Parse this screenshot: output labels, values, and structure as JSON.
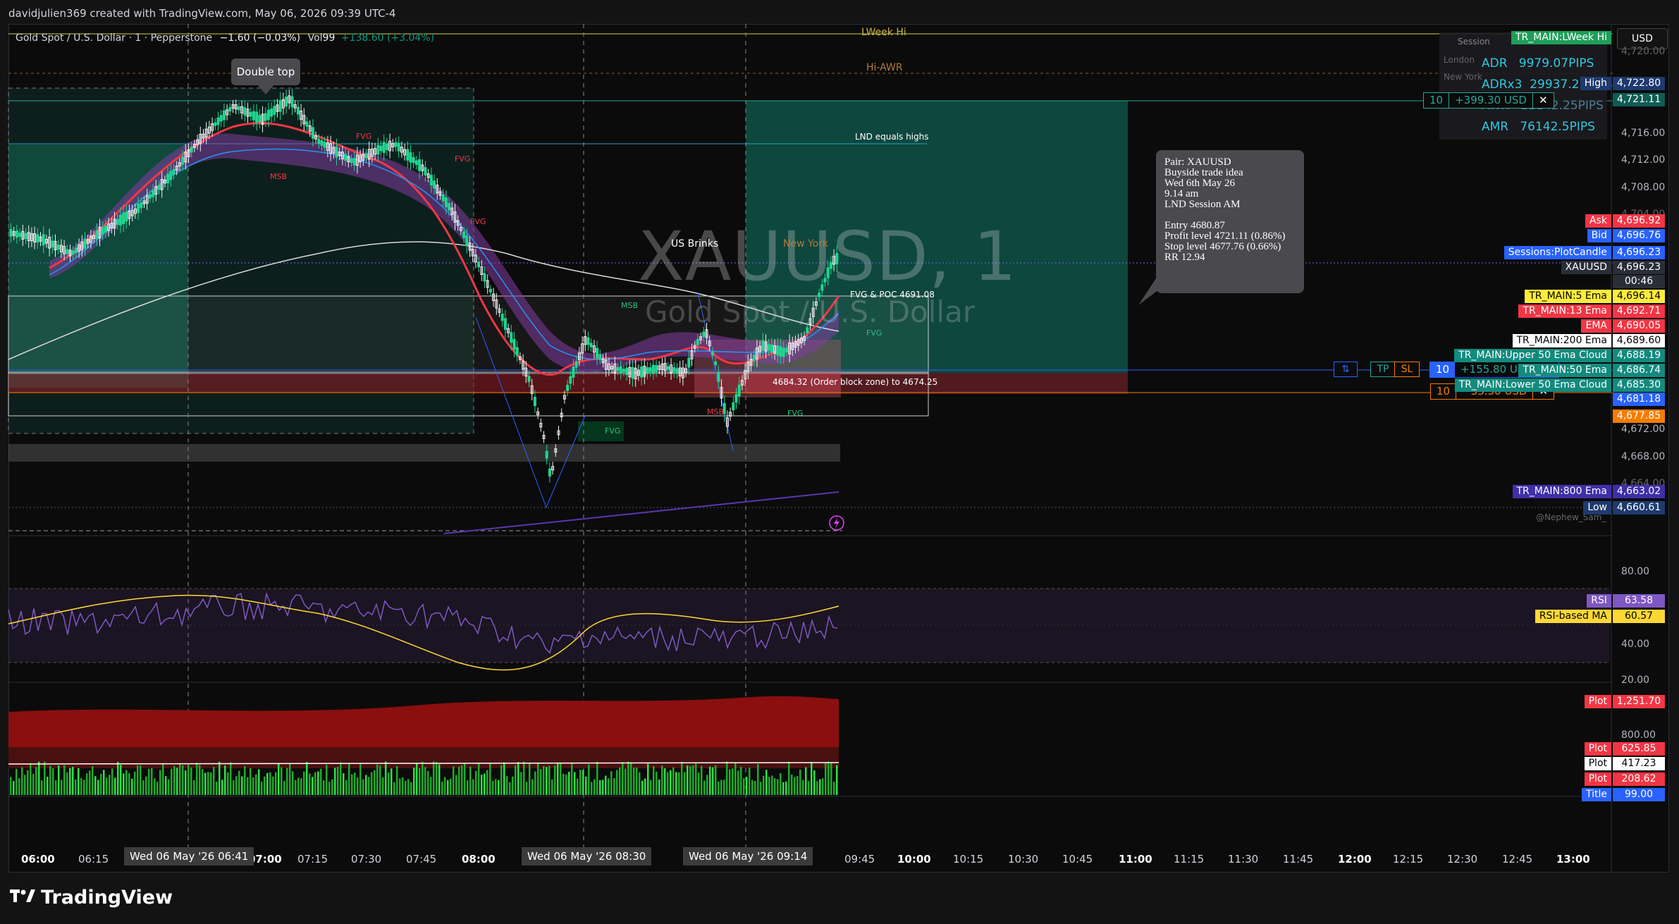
{
  "header": {
    "text": "davidjulien369 created with TradingView.com, May 06, 2026 09:39 UTC-4"
  },
  "legend": {
    "symbol": "Gold Spot / U.S. Dollar · 1 · Pepperstone",
    "change": "−1.60 (−0.03%)",
    "vol_label": "Vol",
    "vol_value": "99",
    "extra": "+138.60 (+3.04%)"
  },
  "watermark": {
    "title": "XAUUSD, 1",
    "subtitle": "Gold Spot / U.S. Dollar"
  },
  "currency_button": "USD",
  "callout": {
    "lines": [
      "Pair: XAUUSD",
      "Buyside trade idea",
      "Wed 6th May 26",
      "9.14 am",
      "LND Session AM",
      "",
      "Entry 4680.87",
      "Profit level 4721.11 (0.86%)",
      "Stop level 4677.76 (0.66%)",
      "RR 12.94"
    ]
  },
  "bubble": "Double top",
  "stats": {
    "session_header": "Session",
    "rows": [
      {
        "label": "ADR",
        "value": "9979.07PIPS"
      },
      {
        "label": "ADRx3",
        "value": "29937.21PIPS"
      },
      {
        "label": "AWR",
        "value": "22142.25PIPS"
      },
      {
        "label": "AMR",
        "value": "76142.5PIPS"
      }
    ],
    "faint": [
      "London",
      "New York"
    ]
  },
  "chart_labels": {
    "lweek_hi": "LWeek Hi",
    "hi_awr": "Hi-AWR",
    "lnd_equals_highs": "LND equals highs",
    "us_brinks": "US Brinks",
    "new_york": "New York",
    "fvg_poc": "FVG & POC 4691.08",
    "order_block": "4684.32 (Order block zone) to 4674.25",
    "fvg": "FVG",
    "msb": "MSB",
    "footer_credit": "@Nephew_Sam_"
  },
  "position": {
    "tp_qty": "10",
    "tp_pnl": "+399.30 USD",
    "mid_qty": "10",
    "mid_pnl": "+155.80 USD",
    "sl_qty": "10",
    "sl_pnl": "−33.30 USD",
    "tp_btn": "TP",
    "sl_btn": "SL",
    "close": "✕"
  },
  "price_axis": {
    "ticks": [
      "4,720.00",
      "4,716.00",
      "4,712.00",
      "4,708.00",
      "4,704.00",
      "4,672.00",
      "4,668.00",
      "4,664.00"
    ],
    "rsi_ticks": [
      "80.00",
      "40.00",
      "20.00"
    ],
    "vol_ticks": [
      "800.00"
    ]
  },
  "price_tags": [
    {
      "name": "TR_MAIN:LWeek Hi",
      "value": "",
      "color": "#1e9e5a"
    },
    {
      "name": "High",
      "value": "4,722.80",
      "color": "#1e3a6e"
    },
    {
      "name": "",
      "value": "4,721.11",
      "color": "#0e5c52"
    },
    {
      "name": "Ask",
      "value": "4,696.92",
      "color": "#f23645"
    },
    {
      "name": "Bid",
      "value": "4,696.76",
      "color": "#2962ff"
    },
    {
      "name": "Sessions:PlotCandle",
      "value": "4,696.23",
      "color": "#2962ff"
    },
    {
      "name": "XAUUSD",
      "value": "4,696.23",
      "color": "#2a2e39"
    },
    {
      "name": "",
      "value": "00:46",
      "color": "#2a2e39"
    },
    {
      "name": "TR_MAIN:5 Ema",
      "value": "4,696.14",
      "color": "#ffeb3b"
    },
    {
      "name": "TR_MAIN:13 Ema",
      "value": "4,692.71",
      "color": "#f23645"
    },
    {
      "name": "EMA",
      "value": "4,690.05",
      "color": "#f23645"
    },
    {
      "name": "TR_MAIN:200 Ema",
      "value": "4,689.60",
      "color": "#ffffff"
    },
    {
      "name": "TR_MAIN:Upper 50 Ema Cloud",
      "value": "4,688.19",
      "color": "#138a7e"
    },
    {
      "name": "TR_MAIN:50 Ema",
      "value": "4,686.74",
      "color": "#138a7e"
    },
    {
      "name": "TR_MAIN:Lower 50 Ema Cloud",
      "value": "4,685.30",
      "color": "#138a7e"
    },
    {
      "name": "",
      "value": "4,681.18",
      "color": "#2962ff"
    },
    {
      "name": "",
      "value": "4,677.85",
      "color": "#f57c00"
    },
    {
      "name": "TR_MAIN:800 Ema",
      "value": "4,663.02",
      "color": "#3f2fa8"
    },
    {
      "name": "Low",
      "value": "4,660.61",
      "color": "#1e3a6e"
    }
  ],
  "rsi_tags": [
    {
      "name": "RSI",
      "value": "63.58",
      "color": "#7e57c2"
    },
    {
      "name": "RSI-based MA",
      "value": "60.57",
      "color": "#fdd835"
    }
  ],
  "vol_tags": [
    {
      "name": "Plot",
      "value": "1,251.70",
      "color": "#f23645"
    },
    {
      "name": "Plot",
      "value": "625.85",
      "color": "#f23645"
    },
    {
      "name": "Plot",
      "value": "417.23",
      "color": "#ffffff"
    },
    {
      "name": "Plot",
      "value": "208.62",
      "color": "#f23645"
    },
    {
      "name": "Title",
      "value": "99.00",
      "color": "#2962ff"
    }
  ],
  "time_axis": {
    "labels": [
      "06:00",
      "06:15",
      "07:00",
      "07:15",
      "07:30",
      "07:45",
      "08:00",
      "09:45",
      "10:00",
      "10:15",
      "10:30",
      "10:45",
      "11:00",
      "11:15",
      "11:30",
      "11:45",
      "12:00",
      "12:15",
      "12:30",
      "12:45",
      "13:00"
    ],
    "bold": [
      "06:00",
      "07:00",
      "08:00",
      "10:00",
      "11:00",
      "12:00",
      "13:00"
    ],
    "crosshairs": [
      "Wed 06 May '26   06:41",
      "Wed 06 May '26   08:30",
      "Wed 06 May '26   09:14"
    ]
  },
  "brand": "TradingView"
}
